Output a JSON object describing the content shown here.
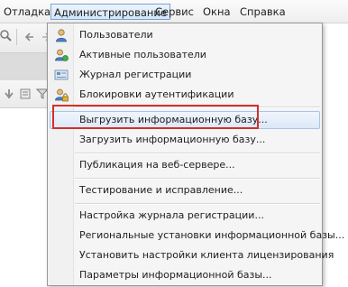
{
  "menubar": {
    "items": [
      {
        "label": "Отладка",
        "active": false
      },
      {
        "label": "Администрирование",
        "active": true
      },
      {
        "label": "Сервис",
        "active": false
      },
      {
        "label": "Окна",
        "active": false
      },
      {
        "label": "Справка",
        "active": false
      }
    ]
  },
  "menu": {
    "items": [
      {
        "label": "Пользователи",
        "icon": "user-icon"
      },
      {
        "label": "Активные пользователи",
        "icon": "active-users-icon"
      },
      {
        "label": "Журнал регистрации",
        "icon": "registration-log-icon"
      },
      {
        "label": "Блокировки аутентификации",
        "icon": "auth-lock-icon"
      },
      {
        "label": "Выгрузить информационную базу...",
        "highlighted": true
      },
      {
        "label": "Загрузить информационную базу..."
      },
      {
        "label": "Публикация на веб-сервере..."
      },
      {
        "label": "Тестирование и исправление..."
      },
      {
        "label": "Настройка журнала регистрации..."
      },
      {
        "label": "Региональные установки информационной базы..."
      },
      {
        "label": "Установить настройки клиента лицензирования"
      },
      {
        "label": "Параметры информационной базы..."
      }
    ]
  },
  "colors": {
    "highlight_border": "#a8c4e8",
    "annotation_box": "#d32f2f"
  }
}
